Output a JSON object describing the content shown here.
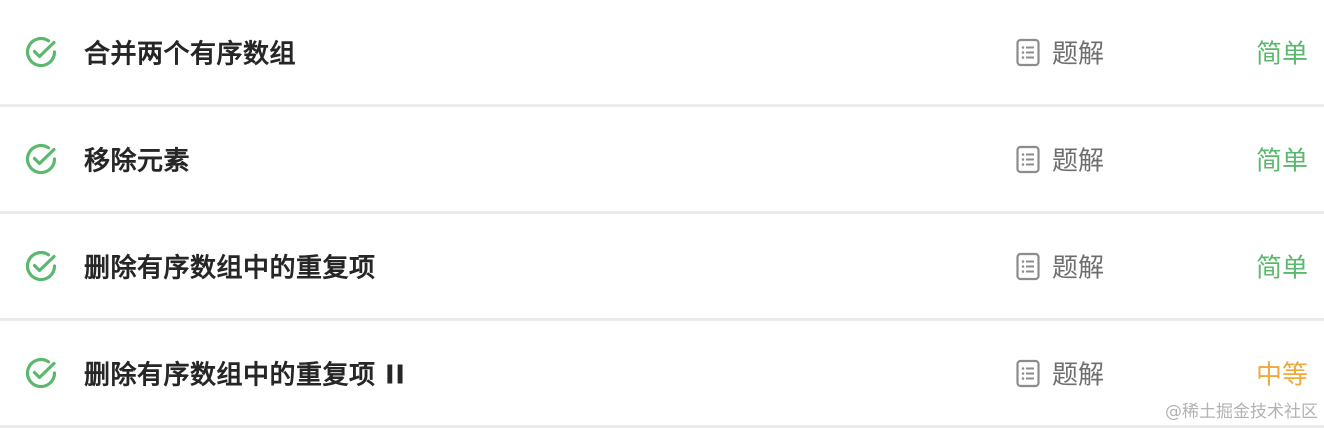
{
  "problems": [
    {
      "title": "合并两个有序数组",
      "solved": true,
      "solution_label": "题解",
      "difficulty": "简单",
      "difficulty_color": "#5cb86e"
    },
    {
      "title": "移除元素",
      "solved": true,
      "solution_label": "题解",
      "difficulty": "简单",
      "difficulty_color": "#5cb86e"
    },
    {
      "title": "删除有序数组中的重复项",
      "solved": true,
      "solution_label": "题解",
      "difficulty": "简单",
      "difficulty_color": "#5cb86e"
    },
    {
      "title": "删除有序数组中的重复项 II",
      "solved": true,
      "solution_label": "题解",
      "difficulty": "中等",
      "difficulty_color": "#f0a93c"
    }
  ],
  "icons": {
    "status": "check-circle-icon",
    "solution": "document-icon"
  },
  "colors": {
    "check": "#5cb86e",
    "doc_icon": "#8c8c8c",
    "divider": "#ebebeb"
  },
  "watermark": "@稀土掘金技术社区"
}
